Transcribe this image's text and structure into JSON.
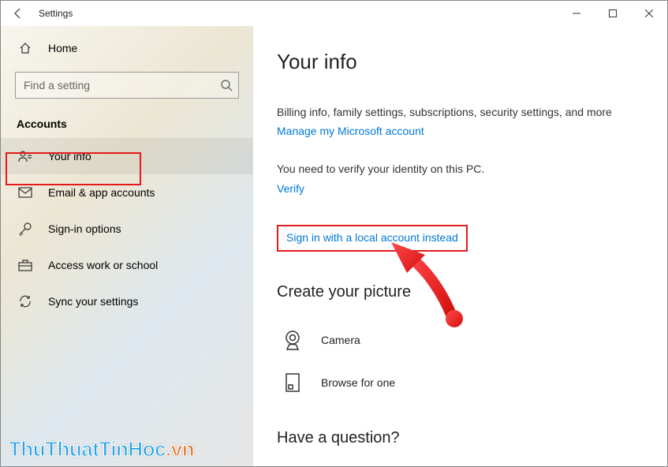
{
  "titlebar": {
    "title": "Settings"
  },
  "sidebar": {
    "home_label": "Home",
    "search_placeholder": "Find a setting",
    "section_title": "Accounts",
    "items": [
      {
        "label": "Your info"
      },
      {
        "label": "Email & app accounts"
      },
      {
        "label": "Sign-in options"
      },
      {
        "label": "Access work or school"
      },
      {
        "label": "Sync your settings"
      }
    ]
  },
  "content": {
    "page_title": "Your info",
    "billing_text": "Billing info, family settings, subscriptions, security settings, and more",
    "manage_link": "Manage my Microsoft account",
    "verify_text": "You need to verify your identity on this PC.",
    "verify_link": "Verify",
    "local_account_link": "Sign in with a local account instead",
    "picture_heading": "Create your picture",
    "camera_label": "Camera",
    "browse_label": "Browse for one",
    "question_heading": "Have a question?"
  },
  "watermark": {
    "main": "ThuThuatTinHoc",
    "suffix": ".vn"
  }
}
